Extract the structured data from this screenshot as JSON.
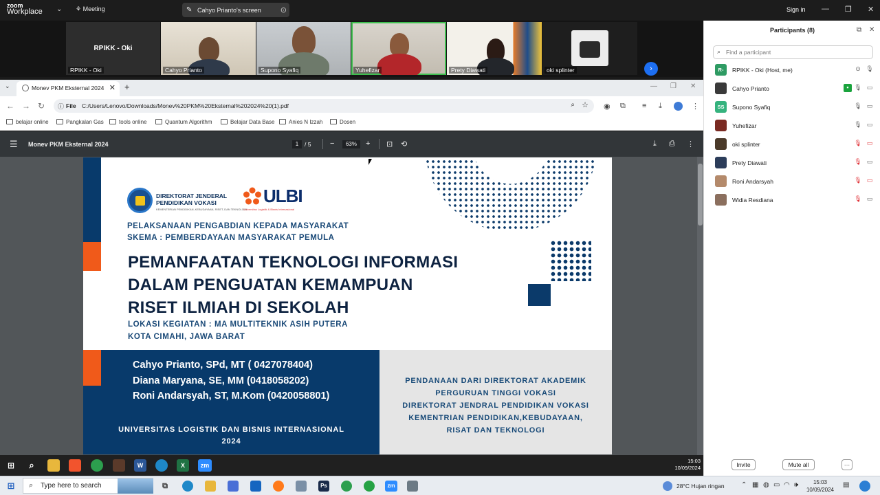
{
  "zoom": {
    "logo_top": "zoom",
    "logo_bottom": "Workplace",
    "meeting_label": "Meeting",
    "share_label": "Cahyo Prianto's screen",
    "signin_label": "Sign in",
    "tiles": [
      {
        "name": "RPIKK - Oki",
        "center": "RPIKK - Oki"
      },
      {
        "name": "Cahyo Prianto"
      },
      {
        "name": "Supono Syafiq"
      },
      {
        "name": "Yuhefizar"
      },
      {
        "name": "Prety Diawati"
      },
      {
        "name": "oki splinter"
      }
    ]
  },
  "browser": {
    "tab_title": "Monev PKM Eksternal 2024",
    "scheme_label": "File",
    "url": "C:/Users/Lenovo/Downloads/Monev%20PKM%20Eksternal%202024%20(1).pdf",
    "bookmarks": [
      "belajar online",
      "Pangkalan Gas",
      "tools online",
      "Quantum Algorithm",
      "Belajar Data Base",
      "Anies N Izzah",
      "Dosen"
    ]
  },
  "pdf": {
    "title": "Monev PKM Eksternal 2024",
    "page_current": "1",
    "page_total": "/  5",
    "zoom": "63%"
  },
  "slide": {
    "logo1_line1": "DIREKTORAT JENDERAL",
    "logo1_line2": "PENDIDIKAN VOKASI",
    "logo1_small": "KEMENTERIAN PENDIDIKAN, KEBUDAYAAN, RISET, DAN TEKNOLOGI",
    "logo2_text": "ULBI",
    "logo2_small": "Universitas Logistik & Bisnis Internasional",
    "sub_line1": "PELAKSANAAN PENGABDIAN KEPADA MASYARAKAT",
    "sub_line2": "SKEMA : PEMBERDAYAAN MASYARAKAT PEMULA",
    "title_line1": "PEMANFAATAN TEKNOLOGI INFORMASI",
    "title_line2": "DALAM PENGUATAN KEMAMPUAN",
    "title_line3": "RISET ILMIAH DI SEKOLAH",
    "loc_line1": "LOKASI KEGIATAN : MA MULTITEKNIK ASIH PUTERA",
    "loc_line2": "KOTA CIMAHI, JAWA BARAT",
    "authors": [
      "Cahyo Prianto, SPd, MT ( 0427078404)",
      "Diana Maryana, SE, MM (0418058202)",
      "Roni Andarsyah, ST, M.Kom (0420058801)"
    ],
    "univ_line1": "UNIVERSITAS LOGISTIK DAN BISNIS INTERNASIONAL",
    "univ_line2": "2024",
    "fund_lines": [
      "PENDANAAN DARI DIREKTORAT AKADEMIK",
      "PERGURUAN TINGGI VOKASI",
      "DIREKTORAT JENDRAL PENDIDIKAN VOKASI",
      "KEMENTRIAN PENDIDIKAN,KEBUDAYAAN,",
      "RISAT DAN TEKNOLOGI"
    ]
  },
  "inner_taskbar": {
    "time": "15:03",
    "date": "10/09/2024"
  },
  "participants": {
    "title": "Participants (8)",
    "search_placeholder": "Find a participant",
    "list": [
      {
        "initials": "R-",
        "name": "RPIKK - Oki (Host, me)",
        "color": "#2e9b63"
      },
      {
        "initials": "",
        "name": "Cahyo Prianto",
        "color": "#3a3a3a"
      },
      {
        "initials": "SS",
        "name": "Supono Syafiq",
        "color": "#35b37e"
      },
      {
        "initials": "",
        "name": "Yuhefizar",
        "color": "#7a2a22"
      },
      {
        "initials": "",
        "name": "oki splinter",
        "color": "#4b3a2a"
      },
      {
        "initials": "",
        "name": "Prety Diawati",
        "color": "#2c3d5a"
      },
      {
        "initials": "",
        "name": "Roni Andarsyah",
        "color": "#b48a6b"
      },
      {
        "initials": "",
        "name": "Widia Resdiana",
        "color": "#8b6f5e"
      }
    ],
    "invite_label": "Invite",
    "mute_all_label": "Mute all",
    "more_label": "···"
  },
  "windows": {
    "search_placeholder": "Type here to search",
    "weather": "28°C  Hujan ringan",
    "time": "15:03",
    "date": "10/09/2024"
  }
}
